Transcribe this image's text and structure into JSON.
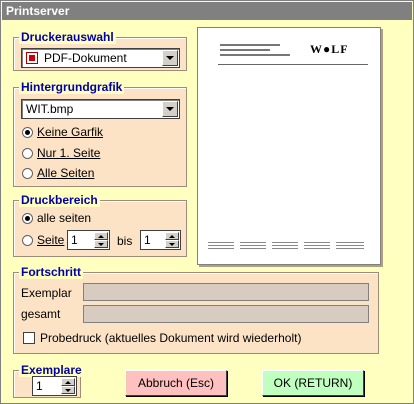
{
  "window": {
    "title": "Printserver"
  },
  "druckerauswahl": {
    "legend": "Druckerauswahl",
    "selected": "PDF-Dokument"
  },
  "hintergrund": {
    "legend": "Hintergrundgrafik",
    "selected": "WIT.bmp",
    "options": [
      {
        "label": "Keine Garfik",
        "checked": true
      },
      {
        "label": "Nur 1. Seite",
        "checked": false
      },
      {
        "label": "Alle Seiten",
        "checked": false
      }
    ]
  },
  "druckbereich": {
    "legend": "Druckbereich",
    "all_label": "alle seiten",
    "page_label": "Seite",
    "from_value": "1",
    "to_label": "bis",
    "to_value": "1"
  },
  "fortschritt": {
    "legend": "Fortschritt",
    "exemplar_label": "Exemplar",
    "gesamt_label": "gesamt",
    "exemplar_progress": 0,
    "gesamt_progress": 0,
    "probedruck_label": "Probedruck (aktuelles Dokument wird wiederholt)",
    "probedruck_checked": false
  },
  "exemplare": {
    "legend": "Exemplare",
    "value": "1"
  },
  "buttons": {
    "cancel": "Abbruch (Esc)",
    "ok": "OK (RETURN)"
  },
  "preview": {
    "logo_text": "W●LF"
  },
  "colors": {
    "background": "#ffffc0",
    "group_fill": "#fde3c6",
    "legend_text": "#0000a8",
    "cancel_button": "#ffc0c0",
    "ok_button": "#c0ffc0"
  }
}
